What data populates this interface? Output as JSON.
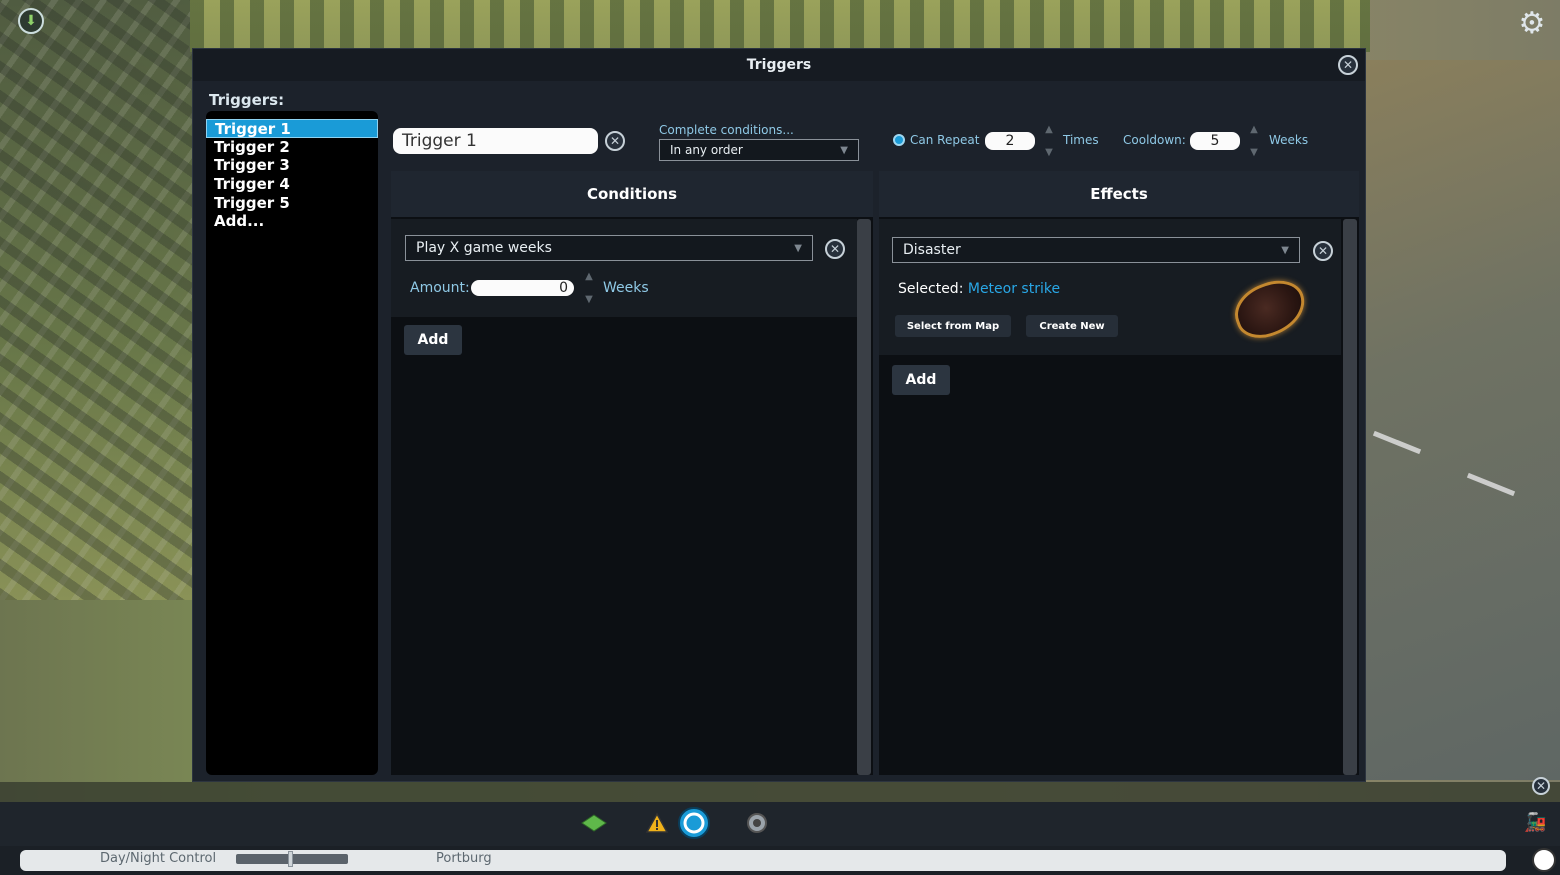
{
  "dialog": {
    "title": "Triggers",
    "triggers_heading": "Triggers:",
    "triggers": [
      "Trigger 1",
      "Trigger 2",
      "Trigger 3",
      "Trigger 4",
      "Trigger 5",
      "Add..."
    ],
    "selected_trigger_index": 0,
    "trigger_name_value": "Trigger 1",
    "complete_conditions_label": "Complete conditions...",
    "complete_conditions_value": "In any order",
    "can_repeat_label": "Can Repeat",
    "can_repeat_checked": true,
    "repeat_times_value": "2",
    "times_label": "Times",
    "cooldown_label": "Cooldown:",
    "cooldown_value": "5",
    "weeks_label": "Weeks"
  },
  "conditions": {
    "header": "Conditions",
    "condition_type": "Play X game weeks",
    "amount_label": "Amount:",
    "amount_value": "0",
    "amount_unit": "Weeks",
    "add_label": "Add"
  },
  "effects": {
    "header": "Effects",
    "effect_type": "Disaster",
    "selected_label": "Selected:",
    "selected_value": "Meteor strike",
    "select_from_map_label": "Select from Map",
    "create_new_label": "Create New",
    "add_label": "Add"
  },
  "status_bar": {
    "day_night_label": "Day/Night Control",
    "day_night_level": 0.47,
    "city_name": "Portburg"
  },
  "icons": {
    "settings": "gear-icon",
    "close": "close-icon",
    "toolbar": [
      "terrain-icon",
      "warning-icon",
      "disaster-triggers-icon",
      "settings-gear-icon"
    ]
  },
  "colors": {
    "accent": "#1a9bd7",
    "link": "#29a7e6",
    "panel_bg": "#0c0f13",
    "dialog_bg": "#1c222b"
  }
}
